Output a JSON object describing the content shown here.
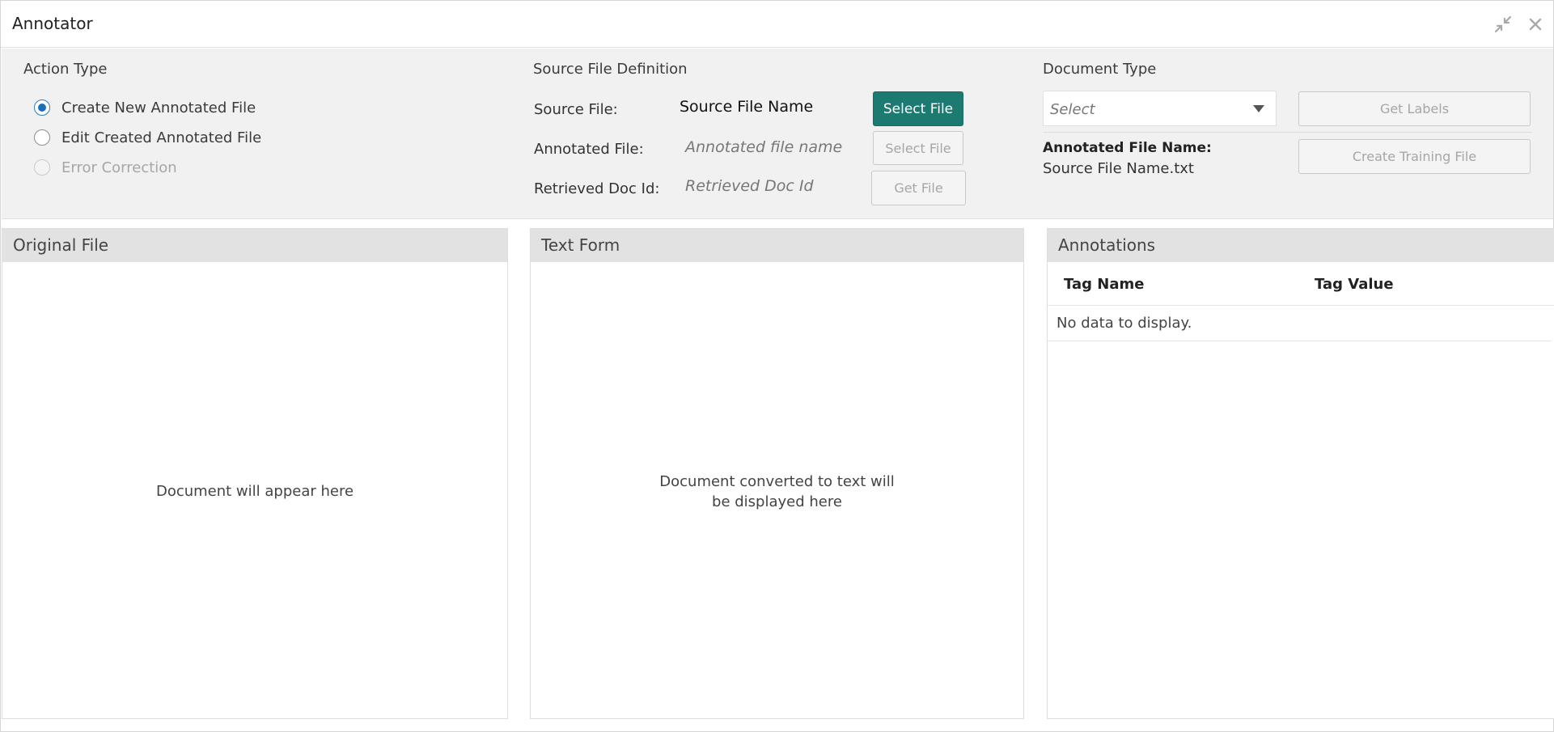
{
  "window": {
    "title": "Annotator",
    "icons": {
      "collapse": "collapse-arrows-icon",
      "close": "close-icon"
    }
  },
  "action_type": {
    "title": "Action Type",
    "options": [
      {
        "label": "Create New Annotated File",
        "checked": true,
        "disabled": false
      },
      {
        "label": "Edit Created Annotated File",
        "checked": false,
        "disabled": false
      },
      {
        "label": "Error Correction",
        "checked": false,
        "disabled": true
      }
    ]
  },
  "source_file_definition": {
    "title": "Source File Definition",
    "source_file_label": "Source File:",
    "source_file_value": "Source File Name",
    "source_select_button": "Select File",
    "annotated_file_label": "Annotated File:",
    "annotated_file_placeholder": "Annotated file name",
    "annotated_select_button": "Select File",
    "retrieved_doc_label": "Retrieved Doc Id:",
    "retrieved_doc_placeholder": "Retrieved Doc Id",
    "get_file_button": "Get File"
  },
  "document_type": {
    "title": "Document Type",
    "select_placeholder": "Select",
    "get_labels_button": "Get Labels",
    "annotated_file_name_label": "Annotated File Name:",
    "annotated_file_name_value": "Source File Name.txt",
    "create_training_button": "Create Training File"
  },
  "panels": {
    "original_file": {
      "title": "Original File",
      "empty_text": "Document will appear here"
    },
    "text_form": {
      "title": "Text Form",
      "empty_line1": "Document converted to text will",
      "empty_line2": "be displayed here"
    },
    "annotations": {
      "title": "Annotations",
      "columns": [
        "Tag Name",
        "Tag Value"
      ],
      "empty_text": "No data to display."
    }
  },
  "colors": {
    "primary_button": "#1c7a70",
    "radio_checked": "#1a6fbd",
    "config_background": "#f1f1f1",
    "panel_header": "#e2e2e2"
  }
}
